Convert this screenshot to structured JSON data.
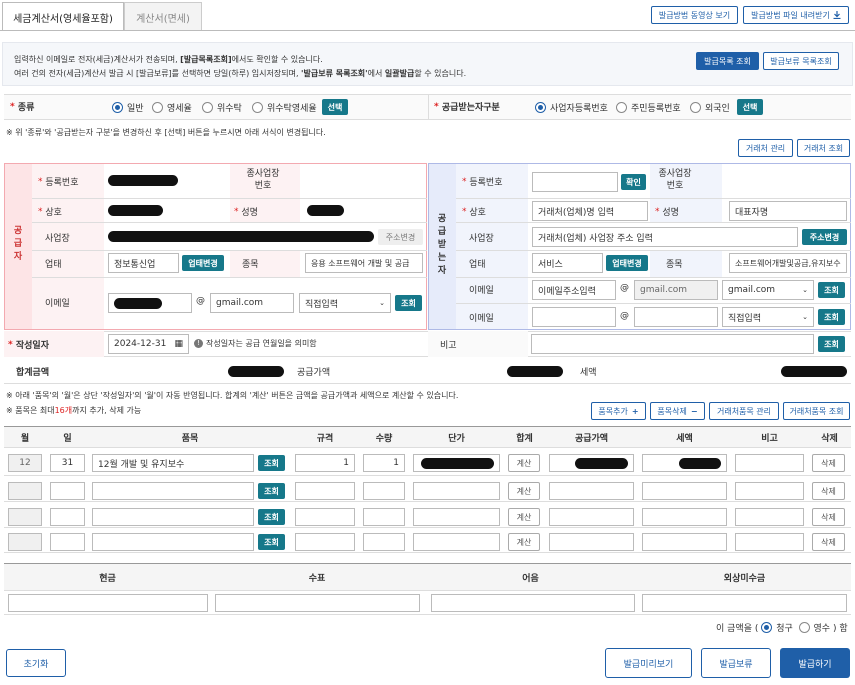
{
  "tabs": [
    "세금계산서(영세율포함)",
    "계산서(면세)"
  ],
  "top_buttons": {
    "video": "발급방법 동영상 보기",
    "download": "발급방법 파일 내려받기",
    "download_icon": "download-icon"
  },
  "info": {
    "line1_a": "입력하신 이메일로 전자(세금)계산서가 전송되며, ",
    "line1_b": "[발급목록조회]",
    "line1_c": "에서도 확인할 수 있습니다.",
    "line2_a": "여러 건의 전자(세금)계산서 발급 시 [발급보류]를 선택하면 당일(하루) 임시저장되며, ",
    "line2_b": "'발급보류 목록조회'",
    "line2_c": "에서 ",
    "line2_d": "일괄발급",
    "line2_e": "할 수 있습니다.",
    "btn_list": "발급목록 조회",
    "btn_hold_list": "발급보류 목록조회"
  },
  "kind": {
    "label": "종류",
    "options": [
      "일반",
      "영세율",
      "위수탁",
      "위수탁영세율"
    ],
    "selected": "일반",
    "select_btn": "선택"
  },
  "buyer_type": {
    "label": "공급받는자구분",
    "options": [
      "사업자등록번호",
      "주민등록번호",
      "외국인"
    ],
    "selected": "사업자등록번호",
    "select_btn": "선택"
  },
  "note_kind": "※ 위 '종류'와 '공급받는자 구분'을 변경하신 후 [선택] 버튼을 누르시면 아래 서식이 변경됩니다.",
  "partner_buttons": {
    "manage": "거래처 관리",
    "search": "거래처 조회"
  },
  "supplier": {
    "side_label": "공급자",
    "reg_no_label": "등록번호",
    "sub_no_label": "종사업장 번호",
    "name_label": "상호",
    "ceo_label": "성명",
    "addr_label": "사업장",
    "addr_change": "주소변경",
    "type_label": "업태",
    "type_value": "정보통신업",
    "type_change": "업태변경",
    "item_label": "종목",
    "item_value": "응용 소프트웨어 개발 및 공급",
    "email_label": "이메일",
    "email_at": "@",
    "email_domain": "gmail.com",
    "email_select": "직접입력",
    "search_btn": "조회"
  },
  "buyer": {
    "side_label": "공급받는자",
    "reg_no_label": "등록번호",
    "confirm_btn": "확인",
    "sub_no_label": "종사업장 번호",
    "name_label": "상호",
    "name_placeholder": "거래처(업체)명 입력",
    "ceo_label": "성명",
    "ceo_placeholder": "대표자명",
    "addr_label": "사업장",
    "addr_placeholder": "거래처(업체) 사업장 주소 입력",
    "addr_change": "주소변경",
    "type_label": "업태",
    "type_value": "서비스",
    "type_change": "업태변경",
    "item_label": "종목",
    "item_value": "소프트웨어개발및공급,유지보수",
    "email_label": "이메일",
    "email1_placeholder": "이메일주소입력",
    "email1_domain": "gmail.com",
    "email1_select": "gmail.com",
    "email2_select": "직접입력",
    "email_at": "@",
    "search_btn": "조회"
  },
  "date_row": {
    "label": "작성일자",
    "value": "2024-12-31",
    "calendar_icon": "calendar-icon",
    "note": "작성일자는 공급 연월일을 의미함",
    "note_icon": "info-icon",
    "remark_label": "비고",
    "search_btn": "조회"
  },
  "totals": {
    "total_label": "합계금액",
    "supply_label": "공급가액",
    "tax_label": "세액"
  },
  "notes2": {
    "line1": "※ 아래 '품목'의 '월'은 상단 '작성일자'의 '월'이 자동 반영됩니다. 합계의 '계산' 버튼은 금액을 공급가액과 세액으로 계산할 수 있습니다.",
    "line2_a": "※ 품목은 최대 ",
    "line2_b": "16개",
    "line2_c": "까지 추가, 삭제 가능"
  },
  "item_buttons": {
    "add": "품목추가",
    "add_icon": "plus-icon",
    "delete": "품목삭제",
    "delete_icon": "minus-icon",
    "manage": "거래처품목 관리",
    "search": "거래처품목 조회"
  },
  "table": {
    "headers": [
      "월",
      "일",
      "품목",
      "규격",
      "수량",
      "단가",
      "합계",
      "공급가액",
      "세액",
      "비고",
      "삭제"
    ],
    "row1": {
      "month": "12",
      "day": "31",
      "item": "12월 개발 및 유지보수",
      "qty": "1",
      "spec": "1"
    },
    "search_btn": "조회",
    "calc_btn": "계산",
    "delete_btn": "삭제"
  },
  "payment": {
    "headers": [
      "현금",
      "수표",
      "어음",
      "외상미수금"
    ]
  },
  "amount_note": {
    "prefix": "이 금액을 (",
    "opt1": "청구",
    "opt2": "영수",
    "suffix": ") 함"
  },
  "bottom": {
    "reset": "초기화",
    "preview": "발급미리보기",
    "hold": "발급보류",
    "issue": "발급하기"
  }
}
